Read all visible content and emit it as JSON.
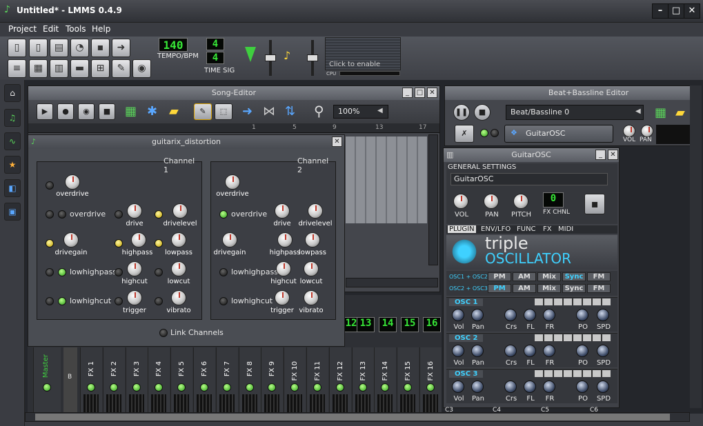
{
  "window": {
    "title": "Untitled* - LMMS 0.4.9"
  },
  "menu": [
    "Project",
    "Edit",
    "Tools",
    "Help"
  ],
  "toolbar": {
    "tempo_value": "140",
    "tempo_label": "TEMPO/BPM",
    "timesig_top": "4",
    "timesig_bottom": "4",
    "timesig_label": "TIME SIG",
    "click_to_enable": "Click to enable",
    "cpu_label": "CPU"
  },
  "song_editor": {
    "title": "Song-Editor",
    "zoom": "100%",
    "ruler": [
      "1",
      "5",
      "9",
      "13",
      "17"
    ]
  },
  "distortion": {
    "title": "guitarix_distortion",
    "ch1_title": "Channel 1",
    "ch2_title": "Channel 2",
    "labels": {
      "overdrive": "overdrive",
      "drive": "drive",
      "drivelevel": "drivelevel",
      "drivegain": "drivegain",
      "highpass": "highpass",
      "lowpass": "lowpass",
      "lowhighpass": "lowhighpass",
      "highcut": "highcut",
      "lowcut": "lowcut",
      "lowhighcut": "lowhighcut",
      "trigger": "trigger",
      "vibrato": "vibrato"
    },
    "link": "Link Channels"
  },
  "bb_editor": {
    "title": "Beat+Bassline Editor",
    "pattern": "Beat/Bassline 0",
    "track": "GuitarOSC",
    "vol": "VOL",
    "pan": "PAN"
  },
  "instrument": {
    "title": "GuitarOSC",
    "general": "GENERAL SETTINGS",
    "name": "GuitarOSC",
    "vol": "VOL",
    "pan": "PAN",
    "pitch": "PITCH",
    "fx": "FX CHNL",
    "fx_value": "0",
    "tabs": [
      "PLUGIN",
      "ENV/LFO",
      "FUNC",
      "FX",
      "MIDI"
    ],
    "logo1": "triple",
    "logo2": "OSCILLATOR",
    "mod1": "OSC1 + OSC2",
    "mod2": "OSC2 + OSC3",
    "mods": [
      "PM",
      "AM",
      "Mix",
      "Sync",
      "FM"
    ],
    "osc": [
      "OSC 1",
      "OSC 2",
      "OSC 3"
    ],
    "knobs": [
      "Vol",
      "Pan",
      "Crs",
      "FL",
      "FR",
      "PO",
      "SPD"
    ],
    "keys": [
      "C3",
      "C4",
      "C5",
      "C6"
    ]
  },
  "mixer": {
    "master": "Master",
    "b": "B",
    "channels": [
      "FX 1",
      "FX 2",
      "FX 3",
      "FX 4",
      "FX 5",
      "FX 6",
      "FX 7",
      "FX 8",
      "FX 9",
      "FX 10",
      "FX 11",
      "FX 12",
      "FX 13",
      "FX 14",
      "FX 15",
      "FX 16"
    ],
    "lcd": [
      "12",
      "13",
      "14",
      "15",
      "16"
    ]
  },
  "colors": {
    "lcd": "#37e837",
    "accent": "#3fd1ff",
    "bg": "#3b3d43"
  }
}
